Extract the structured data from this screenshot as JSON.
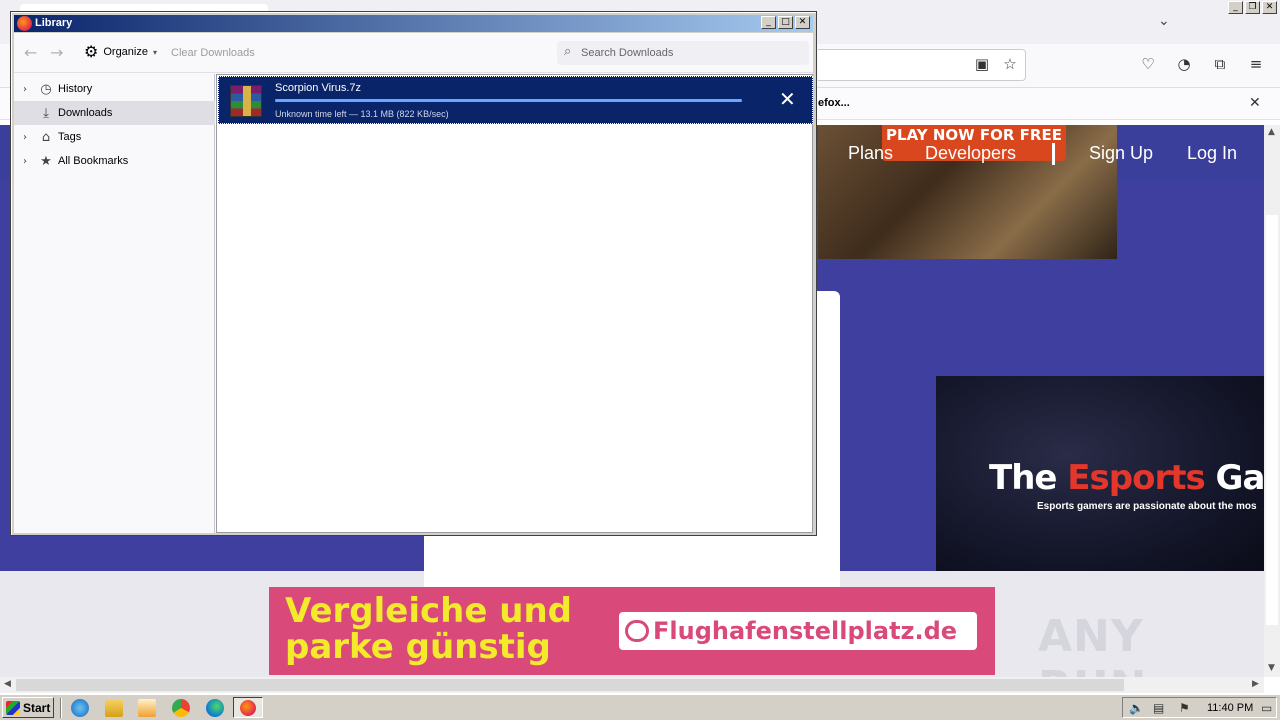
{
  "browser": {
    "notification_text": "efox...",
    "nav": {
      "plans": "Plans",
      "developers": "Developers",
      "signup": "Sign Up",
      "login": "Log In"
    },
    "hero_button": "PLAY NOW FOR FREE",
    "esports": {
      "title_part1": "The ",
      "title_highlight": "Esports",
      "title_part2": " Gam",
      "subtitle": "Esports gamers are passionate about the mos"
    },
    "ad": {
      "line1": "Vergleiche und",
      "line2": "parke günstig",
      "brand": "Flughafenstellplatz.de"
    },
    "watermark": "ANY RUN"
  },
  "library": {
    "title": "Library",
    "toolbar": {
      "organize_label": "Organize",
      "clear_label": "Clear Downloads",
      "search_placeholder": "Search Downloads"
    },
    "sidebar": [
      {
        "label": "History",
        "icon": "clock-icon",
        "expandable": true
      },
      {
        "label": "Downloads",
        "icon": "download-icon",
        "expandable": false,
        "selected": true
      },
      {
        "label": "Tags",
        "icon": "tag-icon",
        "expandable": true
      },
      {
        "label": "All Bookmarks",
        "icon": "star-icon",
        "expandable": true
      }
    ],
    "download": {
      "filename": "Scorpion Virus.7z",
      "status": "Unknown time left — 13.1 MB (822 KB/sec)",
      "progress": 1.0,
      "icon": "winrar-archive-icon"
    }
  },
  "taskbar": {
    "start_label": "Start",
    "clock": "11:40 PM"
  },
  "colors": {
    "selection": "#0a246a",
    "site_purple": "#3f3fa0",
    "ad_pink": "#d94a7a",
    "ad_yellow": "#f2ea2b",
    "esports_red": "#e4372b"
  }
}
